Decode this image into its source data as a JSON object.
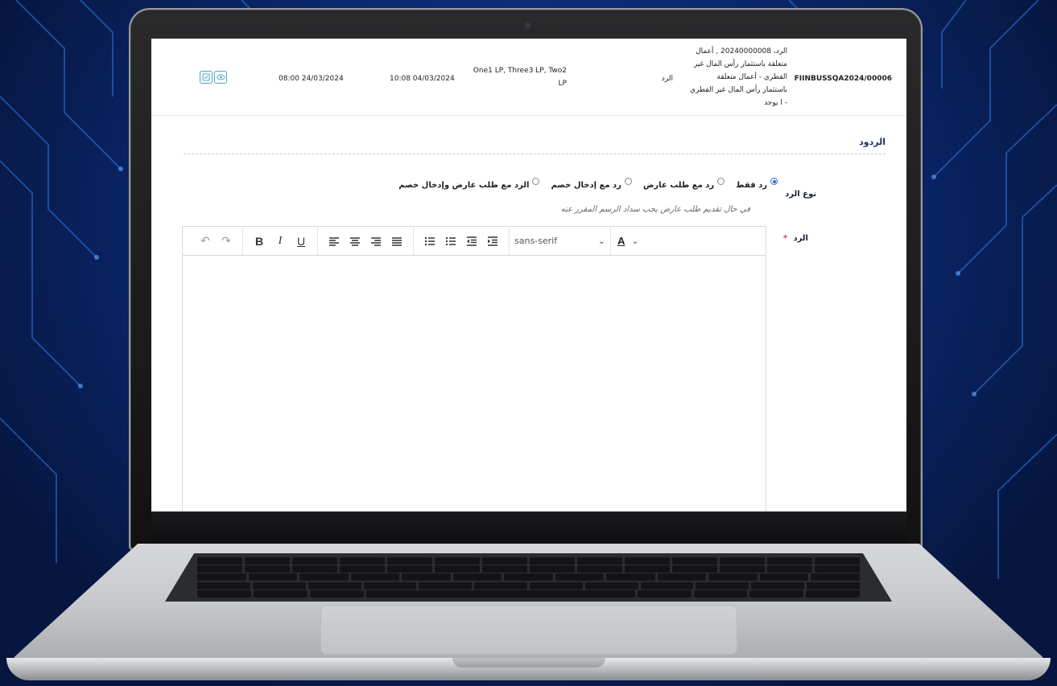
{
  "header": {
    "reference_id": "FIINBUSSQA2024/00006",
    "title_lines": [
      "الرد، 20240000008 , أعمال",
      "متعلقة باستثمار رأس المال غير",
      "القطري - أعمال متعلقة",
      "باستثمار رأس المال غير القطري",
      "- ا يوجد"
    ],
    "type": "الرد",
    "parties": "One1 LP, Three3 LP, Two2 LP",
    "date_created": "10:08 04/03/2024",
    "date_due": "08:00 24/03/2024",
    "icons": [
      "check-square-icon",
      "eye-icon"
    ]
  },
  "section": {
    "title": "الردود"
  },
  "form": {
    "reply_type_label": "نوع الرد",
    "reply_label": "الرد",
    "required_mark": "*",
    "options": [
      {
        "label": "رد فقط",
        "selected": true
      },
      {
        "label": "رد مع طلب عارض",
        "selected": false
      },
      {
        "label": "رد مع إدخال خصم",
        "selected": false
      },
      {
        "label": "الرد مع طلب عارض وإدخال خصم",
        "selected": false
      }
    ],
    "hint": "في حال تقديم طلب عارض يجب سداد الرسم المقرر عنه"
  },
  "editor": {
    "toolbar": {
      "undo": "↶",
      "redo": "↷",
      "bold": "B",
      "italic": "I",
      "underline": "U",
      "font_family": "sans-serif",
      "font_color": "A",
      "chevron": "⌄"
    },
    "content": ""
  },
  "colors": {
    "accent": "#2c6bd6",
    "title": "#1a2f6b",
    "required": "#e23b3b",
    "icon": "#4aa3c9"
  }
}
